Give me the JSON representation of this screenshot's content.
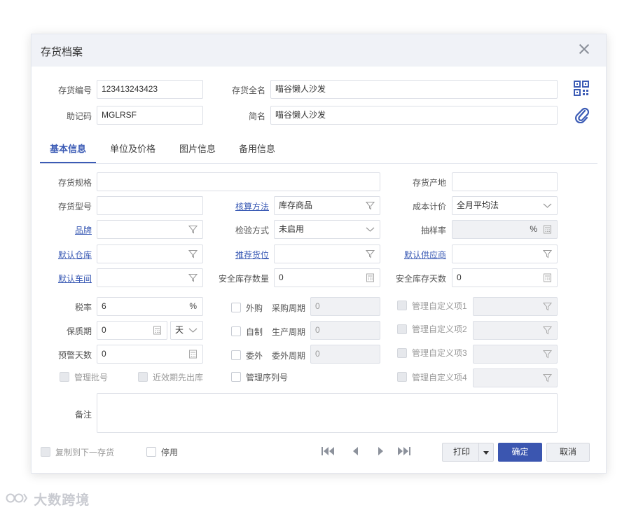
{
  "dialog": {
    "title": "存货档案"
  },
  "header": {
    "code_label": "存货编号",
    "code_value": "123413243423",
    "fullname_label": "存货全名",
    "fullname_value": "喵谷懒人沙发",
    "mnemonic_label": "助记码",
    "mnemonic_value": "MGLRSF",
    "shortname_label": "简名",
    "shortname_value": "喵谷懒人沙发",
    "qr_icon": "qr-code-icon",
    "attach_icon": "paperclip-icon"
  },
  "tabs": [
    {
      "label": "基本信息",
      "active": true
    },
    {
      "label": "单位及价格",
      "active": false
    },
    {
      "label": "图片信息",
      "active": false
    },
    {
      "label": "备用信息",
      "active": false
    }
  ],
  "form": {
    "spec_label": "存货规格",
    "spec_value": "",
    "origin_label": "存货产地",
    "origin_value": "",
    "model_label": "存货型号",
    "model_value": "",
    "accounting_label": "核算方法",
    "accounting_value": "库存商品",
    "costing_label": "成本计价",
    "costing_value": "全月平均法",
    "brand_label": "品牌",
    "brand_value": "",
    "inspect_label": "检验方式",
    "inspect_value": "未启用",
    "sample_label": "抽样率",
    "sample_unit": "%",
    "warehouse_label": "默认仓库",
    "warehouse_value": "",
    "location_label": "推荐货位",
    "location_value": "",
    "supplier_label": "默认供应商",
    "supplier_value": "",
    "workshop_label": "默认车间",
    "workshop_value": "",
    "safety_qty_label": "安全库存数量",
    "safety_qty_value": "0",
    "safety_days_label": "安全库存天数",
    "safety_days_value": "0",
    "tax_label": "税率",
    "tax_value": "6",
    "tax_unit": "%",
    "shelf_label": "保质期",
    "shelf_value": "0",
    "shelf_unit": "天",
    "warn_label": "预警天数",
    "warn_value": "0",
    "outsource_buy_label": "外购",
    "purchase_cycle_label": "采购周期",
    "purchase_cycle_value": "0",
    "self_made_label": "自制",
    "production_cycle_label": "生产周期",
    "production_cycle_value": "0",
    "outsource_label": "委外",
    "outsource_cycle_label": "委外周期",
    "outsource_cycle_value": "0",
    "batch_label": "管理批号",
    "fefo_label": "近效期先出库",
    "serial_label": "管理序列号",
    "custom1_label": "管理自定义项1",
    "custom2_label": "管理自定义项2",
    "custom3_label": "管理自定义项3",
    "custom4_label": "管理自定义项4",
    "remark_label": "备注",
    "remark_value": ""
  },
  "footer": {
    "copy_next_label": "复制到下一存货",
    "disable_label": "停用",
    "print_label": "打印",
    "ok_label": "确定",
    "cancel_label": "取消"
  },
  "watermark": {
    "text": "大数跨境"
  },
  "colors": {
    "accent": "#3b5bb5",
    "primary_button": "#3b56b0",
    "title_bar": "#f0f2f7"
  }
}
